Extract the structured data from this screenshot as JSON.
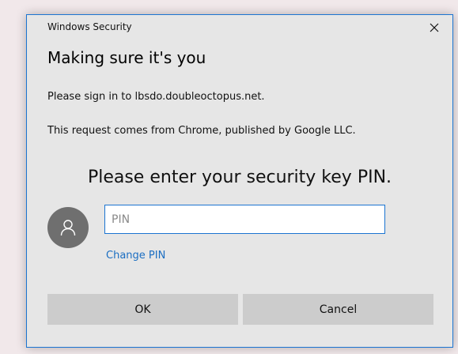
{
  "window": {
    "title": "Windows Security",
    "close_icon": "close-icon"
  },
  "content": {
    "heading": "Making sure it's you",
    "signin_text": "Please sign in to lbsdo.doubleoctopus.net.",
    "request_text": "This request comes from Chrome, published by Google LLC.",
    "prompt": "Please enter your security key PIN."
  },
  "pin_field": {
    "placeholder": "PIN",
    "value": ""
  },
  "links": {
    "change_pin": "Change PIN"
  },
  "buttons": {
    "ok": "OK",
    "cancel": "Cancel"
  },
  "colors": {
    "accent": "#1b74d1",
    "dialog_bg": "#e6e6e6",
    "button_bg": "#cccccc",
    "avatar_bg": "#6f6f6f",
    "link": "#1b6ec2"
  },
  "icons": {
    "avatar": "user-icon"
  }
}
